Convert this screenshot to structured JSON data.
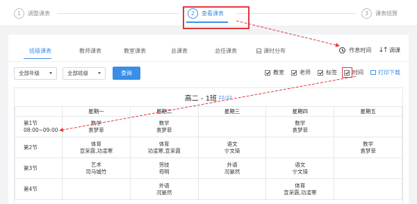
{
  "stepper": {
    "steps": [
      {
        "num": "1",
        "label": "调整课表"
      },
      {
        "num": "2",
        "label": "查看课表"
      },
      {
        "num": "3",
        "label": "课表结算"
      }
    ],
    "active_step": 2
  },
  "tabs": [
    {
      "label": "班级课表"
    },
    {
      "label": "教师课表"
    },
    {
      "label": "教室课表"
    },
    {
      "label": "总课表"
    },
    {
      "label": "总任课表"
    },
    {
      "label": "课时分布"
    }
  ],
  "tools": {
    "schedule_label": "作息时间",
    "adjust_label": "调课"
  },
  "filters": {
    "grade": "全部年级",
    "class": "全部班级",
    "query_label": "查询"
  },
  "checks": [
    {
      "label": "教室",
      "checked": true
    },
    {
      "label": "老师",
      "checked": true
    },
    {
      "label": "标签",
      "checked": true
    },
    {
      "label": "时间",
      "checked": true
    }
  ],
  "print_label": "打印下载",
  "timetable": {
    "title": "高二 - 1班",
    "count": "22/32",
    "headers": [
      "",
      "星期一",
      "星期二",
      "星期三",
      "星期四",
      "星期五"
    ],
    "rows": [
      {
        "period": "第1节",
        "time": "08:00~09:00",
        "cells": [
          [
            "数学",
            "袁梦菲"
          ],
          [
            "数学",
            "袁梦菲"
          ],
          [
            "",
            ""
          ],
          [
            "数学",
            "袁梦菲"
          ],
          [
            "",
            ""
          ]
        ]
      },
      {
        "period": "第2节",
        "time": "",
        "cells": [
          [
            "体育",
            "宣采霞,功凌寒"
          ],
          [
            "体育",
            "功凌寒,宣采霞"
          ],
          [
            "语文",
            "宁文琦"
          ],
          [
            "",
            ""
          ],
          [
            "数学",
            "袁梦菲"
          ]
        ]
      },
      {
        "period": "第3节",
        "time": "",
        "cells": [
          [
            "艺术",
            "司马城竹"
          ],
          [
            "劳技",
            "苟明"
          ],
          [
            "外语",
            "况晏然"
          ],
          [
            "语文",
            "宁文琦"
          ],
          [
            "",
            ""
          ]
        ]
      },
      {
        "period": "第4节",
        "time": "",
        "cells": [
          [
            "",
            ""
          ],
          [
            "外语",
            "况晏然"
          ],
          [
            "",
            ""
          ],
          [
            "体育",
            "宣采霞,功凌寒"
          ],
          [
            "",
            ""
          ]
        ]
      }
    ]
  },
  "colors": {
    "accent": "#3a8ee6",
    "highlight": "#e0353b"
  }
}
